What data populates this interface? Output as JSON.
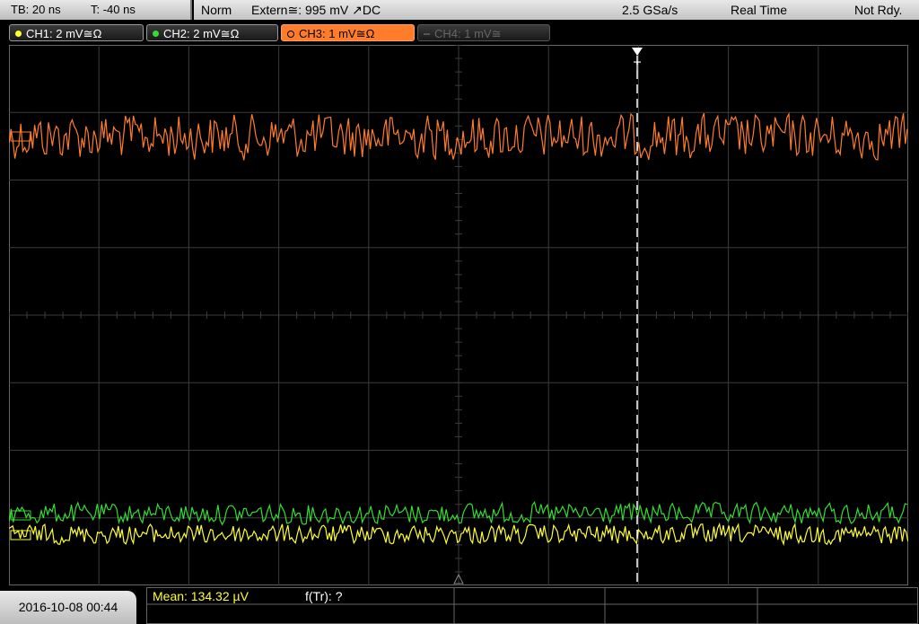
{
  "timebase": {
    "tb": "TB: 20 ns",
    "t": "T: -40 ns"
  },
  "trigger": {
    "mode": "Norm",
    "source": "Extern≅: 995 mV ↗DC",
    "sample_rate": "2.5 GSa/s",
    "acq": "Real Time",
    "status": "Not Rdy."
  },
  "channels": [
    {
      "label": "CH1: 2 mV≅Ω",
      "color": "#ffff33",
      "state": "on"
    },
    {
      "label": "CH2: 2 mV≅Ω",
      "color": "#33dd33",
      "state": "on"
    },
    {
      "label": "CH3: 1 mV≅Ω",
      "color": "#ff7d2a",
      "state": "active"
    },
    {
      "label": "CH4: 1 mV≅",
      "color": "#888888",
      "state": "off"
    }
  ],
  "date": "2016-10-08 00:44",
  "measurements": {
    "mean": "Mean: 134.32 µV",
    "ftr": "f(Tr): ?"
  },
  "trigger_marker": "T",
  "colors": {
    "ch1": "#ffff33",
    "ch2": "#33dd33",
    "ch3": "#ff7d2a",
    "grid": "#3c3c3c"
  }
}
